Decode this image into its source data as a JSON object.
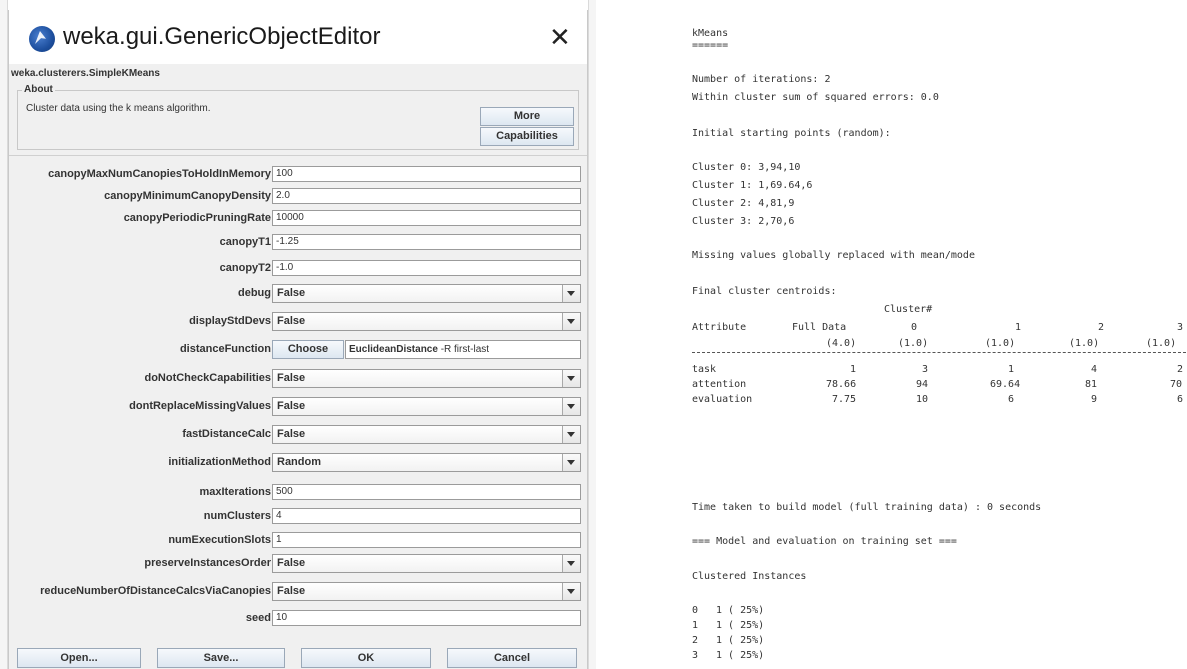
{
  "dialog": {
    "title": "weka.gui.GenericObjectEditor",
    "class_name": "weka.clusterers.SimpleKMeans",
    "about": {
      "legend": "About",
      "description": "Cluster data using the k means algorithm.",
      "more_label": "More",
      "capabilities_label": "Capabilities"
    },
    "properties": {
      "canopyMaxNumCanopiesToHoldInMemory": {
        "label": "canopyMaxNumCanopiesToHoldInMemory",
        "value": "100"
      },
      "canopyMinimumCanopyDensity": {
        "label": "canopyMinimumCanopyDensity",
        "value": "2.0"
      },
      "canopyPeriodicPruningRate": {
        "label": "canopyPeriodicPruningRate",
        "value": "10000"
      },
      "canopyT1": {
        "label": "canopyT1",
        "value": "-1.25"
      },
      "canopyT2": {
        "label": "canopyT2",
        "value": "-1.0"
      },
      "debug": {
        "label": "debug",
        "value": "False"
      },
      "displayStdDevs": {
        "label": "displayStdDevs",
        "value": "False"
      },
      "distanceFunction": {
        "label": "distanceFunction",
        "button": "Choose",
        "name": "EuclideanDistance",
        "args": " -R first-last"
      },
      "doNotCheckCapabilities": {
        "label": "doNotCheckCapabilities",
        "value": "False"
      },
      "dontReplaceMissingValues": {
        "label": "dontReplaceMissingValues",
        "value": "False"
      },
      "fastDistanceCalc": {
        "label": "fastDistanceCalc",
        "value": "False"
      },
      "initializationMethod": {
        "label": "initializationMethod",
        "value": "Random"
      },
      "maxIterations": {
        "label": "maxIterations",
        "value": "500"
      },
      "numClusters": {
        "label": "numClusters",
        "value": "4"
      },
      "numExecutionSlots": {
        "label": "numExecutionSlots",
        "value": "1"
      },
      "preserveInstancesOrder": {
        "label": "preserveInstancesOrder",
        "value": "False"
      },
      "reduceNumberOfDistanceCalcsViaCanopies": {
        "label": "reduceNumberOfDistanceCalcsViaCanopies",
        "value": "False"
      },
      "seed": {
        "label": "seed",
        "value": "10"
      }
    },
    "buttons": {
      "open": "Open...",
      "save": "Save...",
      "ok": "OK",
      "cancel": "Cancel"
    }
  },
  "output": {
    "header": "kMeans",
    "header_underline": "======",
    "iterations": "Number of iterations: 2",
    "sse": "Within cluster sum of squared errors: 0.0",
    "initial_title": "Initial starting points (random):",
    "initial_points": [
      "Cluster 0: 3,94,10",
      "Cluster 1: 1,69.64,6",
      "Cluster 2: 4,81,9",
      "Cluster 3: 2,70,6"
    ],
    "missing": "Missing values globally replaced with mean/mode",
    "centroids_title": "Final cluster centroids:",
    "cluster_hash": "Cluster#",
    "table": {
      "attribute_header": "Attribute",
      "columns": [
        {
          "name": "Full Data",
          "count": "(4.0)"
        },
        {
          "name": "0",
          "count": "(1.0)"
        },
        {
          "name": "1",
          "count": "(1.0)"
        },
        {
          "name": "2",
          "count": "(1.0)"
        },
        {
          "name": "3",
          "count": "(1.0)"
        }
      ],
      "rows": [
        {
          "attr": "task",
          "values": [
            "1",
            "3",
            "1",
            "4",
            "2"
          ]
        },
        {
          "attr": "attention",
          "values": [
            "78.66",
            "94",
            "69.64",
            "81",
            "70"
          ]
        },
        {
          "attr": "evaluation",
          "values": [
            "7.75",
            "10",
            "6",
            "9",
            "6"
          ]
        }
      ]
    },
    "time_taken": "Time taken to build model (full training data) : 0 seconds",
    "model_eval": "=== Model and evaluation on training set ===",
    "clustered_title": "Clustered Instances",
    "clustered_rows": [
      {
        "cluster": "0",
        "stat": "1 ( 25%)"
      },
      {
        "cluster": "1",
        "stat": "1 ( 25%)"
      },
      {
        "cluster": "2",
        "stat": "1 ( 25%)"
      },
      {
        "cluster": "3",
        "stat": "1 ( 25%)"
      }
    ]
  }
}
